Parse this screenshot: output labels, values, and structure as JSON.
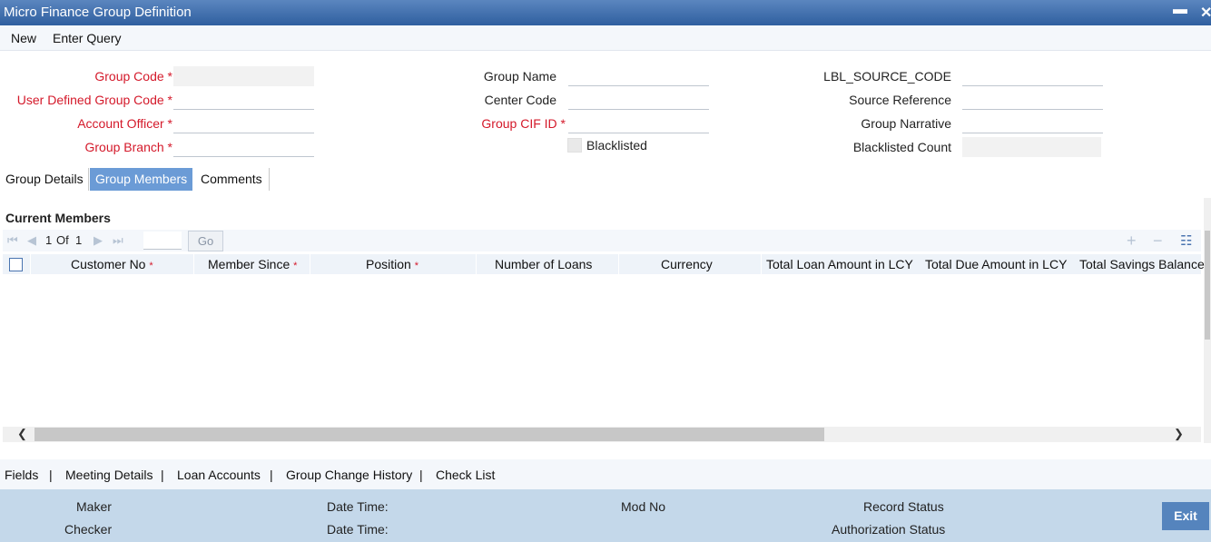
{
  "window": {
    "title": "Micro Finance Group Definition",
    "minimize_glyph": "▬",
    "close_glyph": "✕"
  },
  "menu": {
    "new": "New",
    "enter_query": "Enter Query"
  },
  "form": {
    "group_code": {
      "label": "Group Code",
      "required": "*",
      "value": ""
    },
    "user_defined_group_code": {
      "label": "User Defined Group Code",
      "required": "*",
      "value": ""
    },
    "account_officer": {
      "label": "Account Officer",
      "required": "*",
      "value": ""
    },
    "group_branch": {
      "label": "Group Branch",
      "required": "*",
      "value": ""
    },
    "group_name": {
      "label": "Group Name",
      "value": ""
    },
    "center_code": {
      "label": "Center Code",
      "value": ""
    },
    "group_cif_id": {
      "label": "Group CIF ID",
      "required": "*",
      "value": ""
    },
    "blacklisted": {
      "label": "Blacklisted",
      "checked": false
    },
    "source_code": {
      "label": "LBL_SOURCE_CODE",
      "value": ""
    },
    "source_reference": {
      "label": "Source Reference",
      "value": ""
    },
    "group_narrative": {
      "label": "Group Narrative",
      "value": ""
    },
    "blacklisted_count": {
      "label": "Blacklisted Count",
      "value": ""
    }
  },
  "tabs": [
    {
      "label": "Group Details",
      "active": false
    },
    {
      "label": "Group Members",
      "active": true
    },
    {
      "label": "Comments",
      "active": false
    }
  ],
  "members": {
    "section_title": "Current Members",
    "pager": {
      "page": "1",
      "of_label": "Of",
      "total": "1",
      "go_label": "Go",
      "goto_value": ""
    },
    "columns": [
      {
        "label": "Customer No",
        "required": "*"
      },
      {
        "label": "Member Since",
        "required": "*"
      },
      {
        "label": "Position",
        "required": "*"
      },
      {
        "label": "Number of Loans"
      },
      {
        "label": "Currency"
      },
      {
        "label": "Total Loan Amount in LCY"
      },
      {
        "label": "Total Due Amount in LCY"
      },
      {
        "label": "Total Savings Balance"
      }
    ],
    "rows": [],
    "scroll_fraction_visible": 0.67
  },
  "icons": {
    "first": "first-page-icon",
    "prev": "prev-page-icon",
    "next": "next-page-icon",
    "last": "last-page-icon",
    "add": "add-row-icon",
    "delete": "delete-row-icon",
    "view": "single-view-icon",
    "scroll_left": "scroll-left-icon",
    "scroll_right": "scroll-right-icon"
  },
  "footer_links": [
    "Fields",
    "Meeting Details",
    "Loan Accounts",
    "Group Change History",
    "Check List"
  ],
  "footer_sep": "|",
  "status": {
    "maker": "Maker",
    "checker": "Checker",
    "date_time_1": "Date Time:",
    "date_time_2": "Date Time:",
    "mod_no": "Mod No",
    "record_status": "Record Status",
    "authorization_status": "Authorization Status",
    "exit": "Exit"
  },
  "colors": {
    "accent": "#2f5f9f",
    "required": "#d4192a",
    "active_tab": "#6b9bd6",
    "status_bar": "#c4d8ea",
    "exit_button": "#5584bd"
  }
}
